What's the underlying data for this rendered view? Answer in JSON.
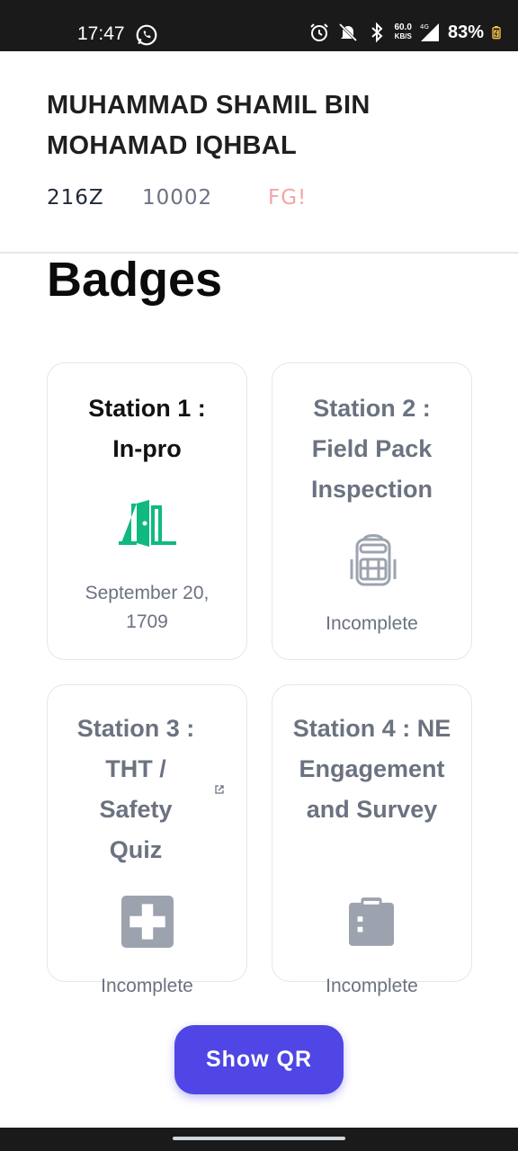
{
  "status_bar": {
    "time": "17:47",
    "speed_top": "60.0",
    "speed_bottom": "KB/S",
    "network": "4G",
    "battery": "83%",
    "icons": [
      "whatsapp-icon",
      "alarm-icon",
      "mute-icon",
      "bluetooth-icon",
      "signal-icon",
      "battery-icon"
    ]
  },
  "profile": {
    "name": "MUHAMMAD SHAMIL BIN MOHAMAD IQHBAL",
    "unit": "216Z",
    "number": "10002",
    "flag": "FG!"
  },
  "page": {
    "title": "Badges"
  },
  "badges": [
    {
      "title": "Station 1 : In-pro",
      "status": "September 20, 1709",
      "icon": "door-open-icon",
      "completed": true
    },
    {
      "title": "Station 2 : Field Pack Inspection",
      "status": "Incomplete",
      "icon": "backpack-icon",
      "completed": false
    },
    {
      "title": "Station 3 : THT / Safety Quiz",
      "status": "Incomplete",
      "icon": "first-aid-icon",
      "completed": false,
      "external_link": true
    },
    {
      "title": "Station 4 : NE Engagement and Survey",
      "status": "Incomplete",
      "icon": "clipboard-icon",
      "completed": false
    }
  ],
  "actions": {
    "show_qr": "Show QR"
  },
  "colors": {
    "accent": "#4f46e5",
    "complete_icon": "#10b981",
    "pending": "#6b7280",
    "flag": "#f4a5a5"
  }
}
